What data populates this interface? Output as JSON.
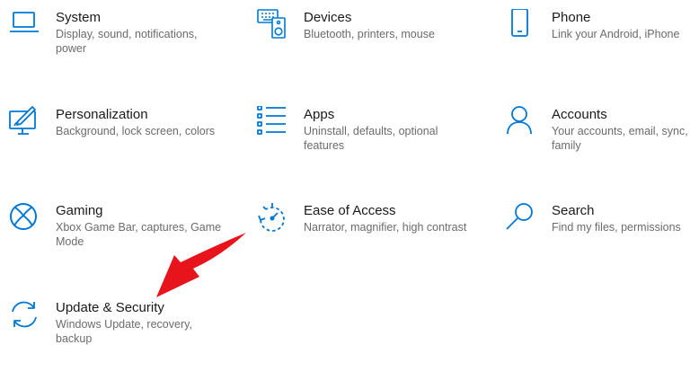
{
  "accent_color": "#0078d4",
  "annotation_color": "#e8141b",
  "tiles": [
    {
      "name": "system",
      "title": "System",
      "description": "Display, sound, notifications, power",
      "icon": "laptop-icon"
    },
    {
      "name": "devices",
      "title": "Devices",
      "description": "Bluetooth, printers, mouse",
      "icon": "keyboard-speaker-icon"
    },
    {
      "name": "phone",
      "title": "Phone",
      "description": "Link your Android, iPhone",
      "icon": "phone-icon"
    },
    {
      "name": "personalization",
      "title": "Personalization",
      "description": "Background, lock screen, colors",
      "icon": "paint-monitor-icon"
    },
    {
      "name": "apps",
      "title": "Apps",
      "description": "Uninstall, defaults, optional features",
      "icon": "list-icon"
    },
    {
      "name": "accounts",
      "title": "Accounts",
      "description": "Your accounts, email, sync, work, family",
      "icon": "person-icon"
    },
    {
      "name": "gaming",
      "title": "Gaming",
      "description": "Xbox Game Bar, captures, Game Mode",
      "icon": "xbox-icon"
    },
    {
      "name": "ease-of-access",
      "title": "Ease of Access",
      "description": "Narrator, magnifier, high contrast",
      "icon": "ease-of-access-icon"
    },
    {
      "name": "search",
      "title": "Search",
      "description": "Find my files, permissions",
      "icon": "magnifier-icon"
    },
    {
      "name": "update-security",
      "title": "Update & Security",
      "description": "Windows Update, recovery, backup",
      "icon": "sync-arrows-icon"
    }
  ]
}
